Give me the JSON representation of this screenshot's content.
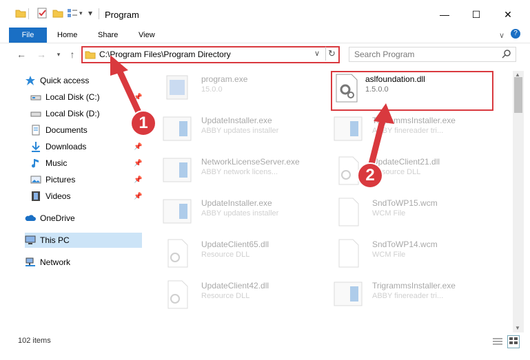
{
  "window": {
    "title": "Program",
    "controls": {
      "minimize": "—",
      "maximize": "☐",
      "close": "✕"
    }
  },
  "ribbon": {
    "tabs": [
      "File",
      "Home",
      "Share",
      "View"
    ],
    "help": "?"
  },
  "address": {
    "path": "C:\\Program Files\\Program Directory",
    "search_placeholder": "Search Program"
  },
  "sidebar": {
    "items": [
      {
        "label": "Quick access",
        "icon": "star-icon",
        "pinned": false
      },
      {
        "label": "Local Disk (C:)",
        "icon": "drive-icon",
        "pinned": true
      },
      {
        "label": "Local Disk (D:)",
        "icon": "drive-icon",
        "pinned": false
      },
      {
        "label": "Documents",
        "icon": "documents-icon",
        "pinned": false
      },
      {
        "label": "Downloads",
        "icon": "download-icon",
        "pinned": true
      },
      {
        "label": "Music",
        "icon": "music-icon",
        "pinned": true
      },
      {
        "label": "Pictures",
        "icon": "pictures-icon",
        "pinned": true
      },
      {
        "label": "Videos",
        "icon": "videos-icon",
        "pinned": true
      },
      {
        "label": "OneDrive",
        "icon": "cloud-icon",
        "pinned": false
      },
      {
        "label": "This PC",
        "icon": "pc-icon",
        "pinned": false
      },
      {
        "label": "Network",
        "icon": "network-icon",
        "pinned": false
      }
    ]
  },
  "files": {
    "col1": [
      {
        "name": "program.exe",
        "sub": "15.0.0"
      },
      {
        "name": "UpdateInstaller.exe",
        "sub": "ABBY updates installer"
      },
      {
        "name": "NetworkLicenseServer.exe",
        "sub": "ABBY network licens..."
      },
      {
        "name": "UpdateInstaller.exe",
        "sub": "ABBY updates installer"
      },
      {
        "name": "UpdateClient65.dll",
        "sub": "Resource DLL"
      },
      {
        "name": "UpdateClient42.dll",
        "sub": "Resource DLL"
      }
    ],
    "col2": [
      {
        "name": "aslfoundation.dll",
        "sub": "1.5.0.0"
      },
      {
        "name": "TrigrammsInstaller.exe",
        "sub": "ABBY finereader tri..."
      },
      {
        "name": "UpdateClient21.dll",
        "sub": "Resource DLL"
      },
      {
        "name": "SndToWP15.wcm",
        "sub": "WCM File"
      },
      {
        "name": "SndToWP14.wcm",
        "sub": "WCM File"
      },
      {
        "name": "TrigrammsInstaller.exe",
        "sub": "ABBY finereader tri..."
      }
    ]
  },
  "status": {
    "count": "102 items"
  },
  "annotations": {
    "badge1": "1",
    "badge2": "2"
  },
  "colors": {
    "accent": "#1a6fc4",
    "highlight": "#d9393e",
    "selection": "#cce4f7"
  }
}
